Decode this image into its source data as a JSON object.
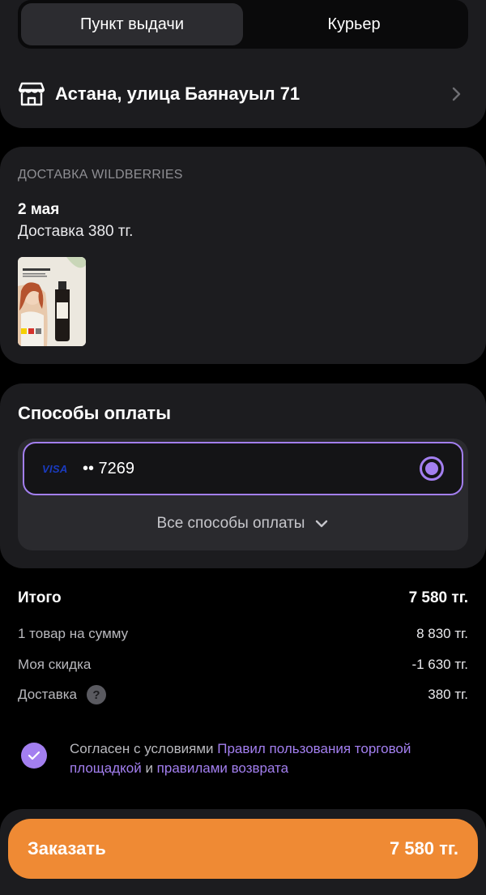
{
  "delivery_mode": {
    "tabs": [
      "Пункт выдачи",
      "Курьер"
    ],
    "active": "Пункт выдачи"
  },
  "address": {
    "text": "Астана, улица Баянауыл 71",
    "icon": "store-icon"
  },
  "delivery": {
    "title": "ДОСТАВКА WILDBERRIES",
    "date": "2 мая",
    "price_text": "Доставка 380 тг.",
    "product": {
      "brand": "ЛИМФОТЕК",
      "subtitle": "ВЫВЕДЕНИЕ ЛИШНЕЙ ЖИДКОСТИ И ТОКСИНОВ"
    }
  },
  "payment": {
    "title": "Способы оплаты",
    "card_brand": "VISA",
    "card_number": "•• 7269",
    "all_methods": "Все способы оплаты",
    "selected": true
  },
  "totals": {
    "total_label": "Итого",
    "total_value": "7 580 тг.",
    "items_label": "1 товар на сумму",
    "items_value": "8 830 тг.",
    "discount_label": "Моя скидка",
    "discount_value": "-1 630 тг.",
    "delivery_label": "Доставка",
    "delivery_value": "380 тг.",
    "help_glyph": "?"
  },
  "agreement": {
    "checked": true,
    "text_prefix": "Согласен с условиями ",
    "link1": "Правил пользования торговой площадкой",
    "text_mid": " и ",
    "link2": "правилами возврата"
  },
  "order": {
    "label": "Заказать",
    "amount": "7 580 тг."
  },
  "colors": {
    "accent": "#a37ff0",
    "order_button": "#ef8a34",
    "card_bg": "#1c1c1f",
    "page_bg": "#000000"
  }
}
